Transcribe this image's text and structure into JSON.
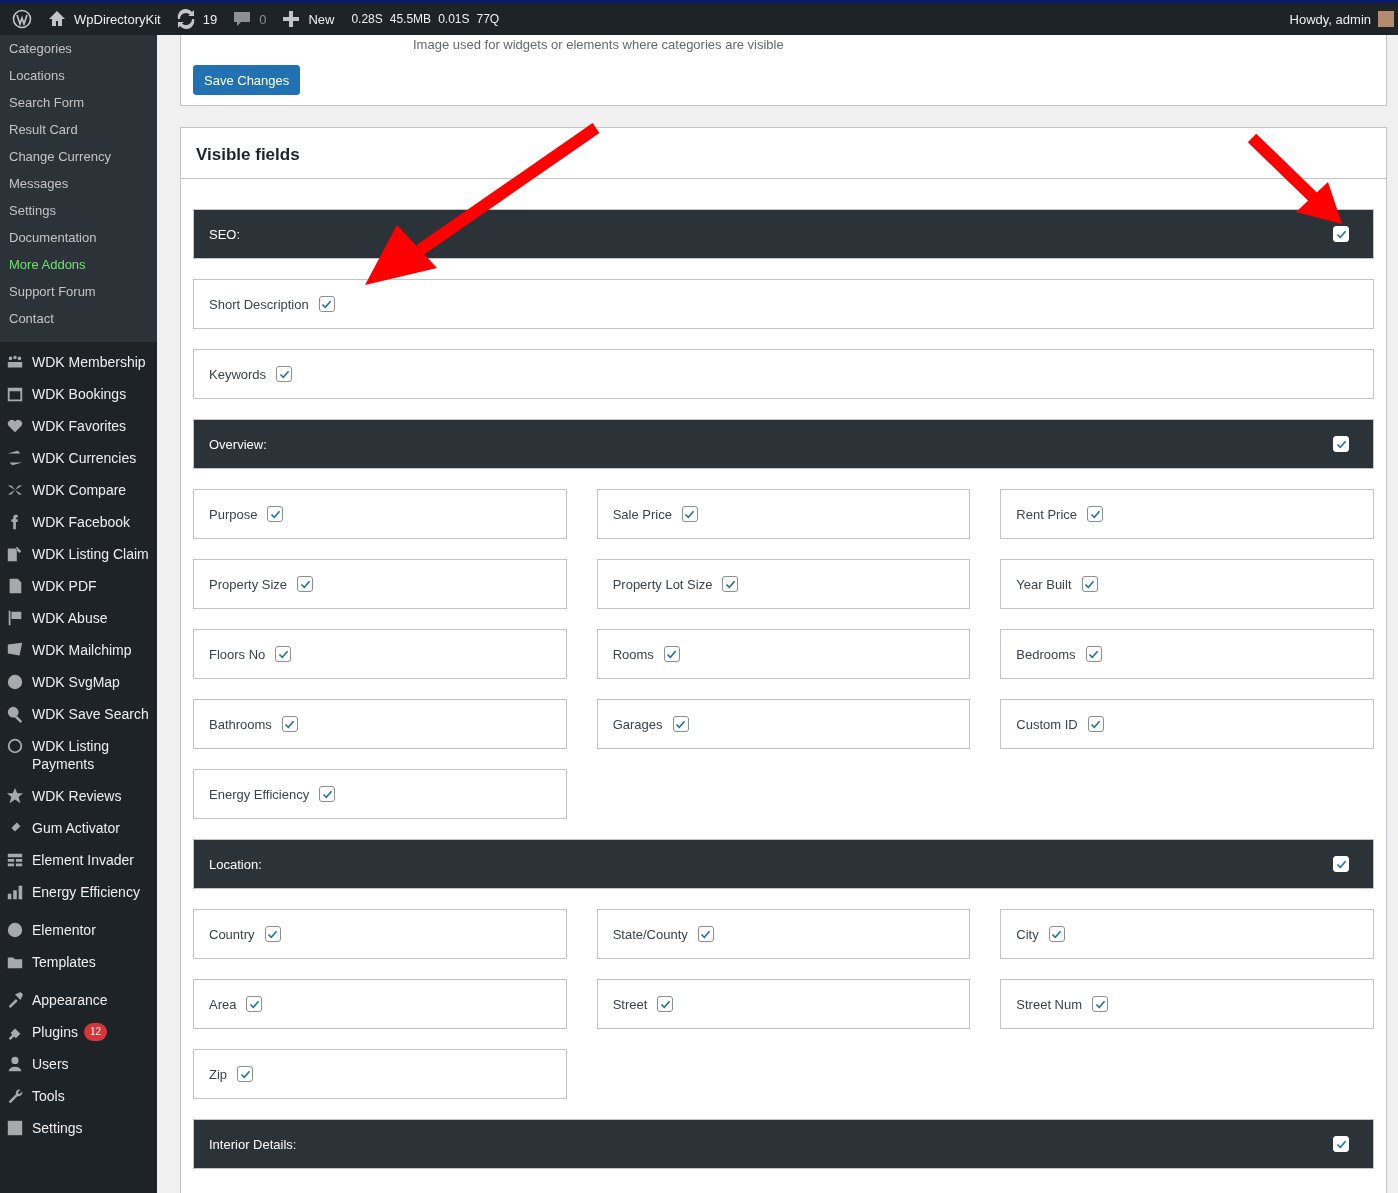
{
  "admin_bar": {
    "site_name": "WpDirectoryKit",
    "updates": "19",
    "comments": "0",
    "new_label": "New",
    "stats": [
      "0.28S",
      "45.5MB",
      "0.01S",
      "77Q"
    ],
    "greeting": "Howdy, admin"
  },
  "sidebar": {
    "submenu": [
      {
        "label": "Categories",
        "highlighted": false
      },
      {
        "label": "Locations",
        "highlighted": false
      },
      {
        "label": "Search Form",
        "highlighted": false
      },
      {
        "label": "Result Card",
        "highlighted": false
      },
      {
        "label": "Change Currency",
        "highlighted": false
      },
      {
        "label": "Messages",
        "highlighted": false
      },
      {
        "label": "Settings",
        "highlighted": false
      },
      {
        "label": "Documentation",
        "highlighted": false
      },
      {
        "label": "More Addons",
        "highlighted": true
      },
      {
        "label": "Support Forum",
        "highlighted": false
      },
      {
        "label": "Contact",
        "highlighted": false
      }
    ],
    "menu_groups": [
      [
        {
          "label": "WDK Membership"
        },
        {
          "label": "WDK Bookings"
        },
        {
          "label": "WDK Favorites"
        },
        {
          "label": "WDK Currencies"
        },
        {
          "label": "WDK Compare"
        },
        {
          "label": "WDK Facebook"
        },
        {
          "label": "WDK Listing Claim"
        },
        {
          "label": "WDK PDF"
        },
        {
          "label": "WDK Abuse"
        },
        {
          "label": "WDK Mailchimp"
        },
        {
          "label": "WDK SvgMap"
        },
        {
          "label": "WDK Save Search"
        },
        {
          "label": "WDK Listing Payments"
        },
        {
          "label": "WDK Reviews"
        },
        {
          "label": "Gum Activator"
        },
        {
          "label": "Element Invader"
        },
        {
          "label": "Energy Efficiency"
        }
      ],
      [
        {
          "label": "Elementor"
        },
        {
          "label": "Templates"
        }
      ],
      [
        {
          "label": "Appearance"
        },
        {
          "label": "Plugins",
          "badge": "12"
        },
        {
          "label": "Users"
        },
        {
          "label": "Tools"
        },
        {
          "label": "Settings"
        }
      ]
    ]
  },
  "top_card": {
    "description": "Image used for widgets or elements where categories are visible",
    "button": "Save Changes"
  },
  "visible_fields": {
    "title": "Visible fields",
    "sections": [
      {
        "title": "SEO:",
        "checked": true,
        "kind": "full",
        "fields": [
          {
            "label": "Short Description",
            "checked": true
          },
          {
            "label": "Keywords",
            "checked": true
          }
        ]
      },
      {
        "title": "Overview:",
        "checked": true,
        "kind": "grid",
        "fields": [
          {
            "label": "Purpose",
            "checked": true
          },
          {
            "label": "Sale Price",
            "checked": true
          },
          {
            "label": "Rent Price",
            "checked": true
          },
          {
            "label": "Property Size",
            "checked": true
          },
          {
            "label": "Property Lot Size",
            "checked": true
          },
          {
            "label": "Year Built",
            "checked": true
          },
          {
            "label": "Floors No",
            "checked": true
          },
          {
            "label": "Rooms",
            "checked": true
          },
          {
            "label": "Bedrooms",
            "checked": true
          },
          {
            "label": "Bathrooms",
            "checked": true
          },
          {
            "label": "Garages",
            "checked": true
          },
          {
            "label": "Custom ID",
            "checked": true
          },
          {
            "label": "Energy Efficiency",
            "checked": true
          }
        ]
      },
      {
        "title": "Location:",
        "checked": true,
        "kind": "grid",
        "fields": [
          {
            "label": "Country",
            "checked": true
          },
          {
            "label": "State/County",
            "checked": true
          },
          {
            "label": "City",
            "checked": true
          },
          {
            "label": "Area",
            "checked": true
          },
          {
            "label": "Street",
            "checked": true
          },
          {
            "label": "Street Num",
            "checked": true
          },
          {
            "label": "Zip",
            "checked": true
          }
        ]
      },
      {
        "title": "Interior Details:",
        "checked": true
      }
    ]
  }
}
